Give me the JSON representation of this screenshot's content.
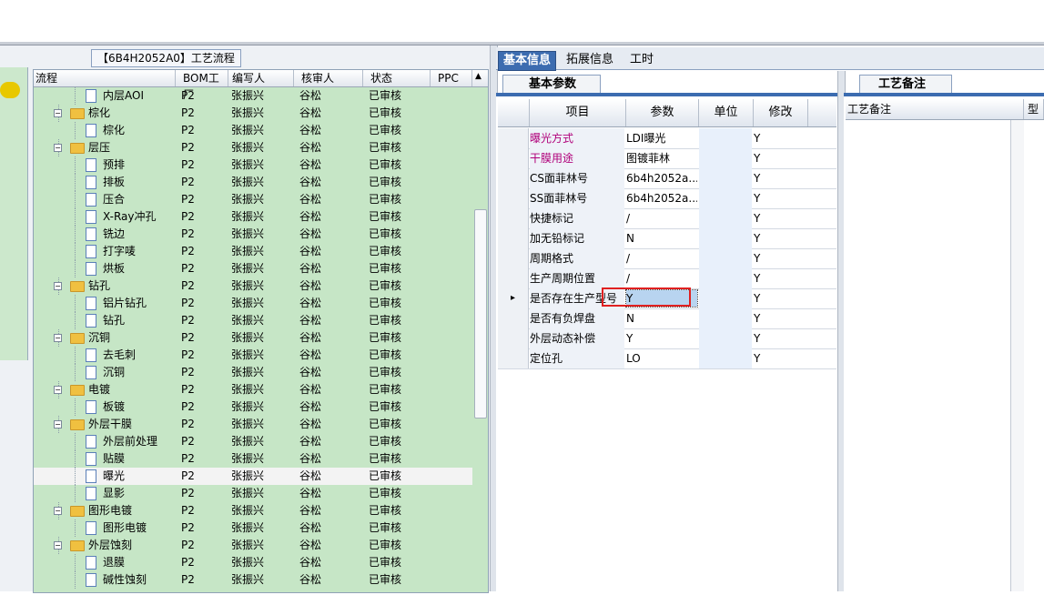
{
  "left": {
    "title": "【6B4H2052A0】工艺流程",
    "columns": [
      "流程",
      "BOM工厂",
      "编写人",
      "核审人",
      "状态",
      "PPC"
    ],
    "rows": [
      {
        "level": 2,
        "kind": "doc",
        "name": "内层AOI",
        "bom": "P2",
        "writer": "张振兴",
        "reviewer": "谷松",
        "status": "已审核"
      },
      {
        "level": 1,
        "kind": "folder",
        "name": "棕化",
        "bom": "P2",
        "writer": "张振兴",
        "reviewer": "谷松",
        "status": "已审核"
      },
      {
        "level": 2,
        "kind": "doc",
        "name": "棕化",
        "bom": "P2",
        "writer": "张振兴",
        "reviewer": "谷松",
        "status": "已审核"
      },
      {
        "level": 1,
        "kind": "folder",
        "name": "层压",
        "bom": "P2",
        "writer": "张振兴",
        "reviewer": "谷松",
        "status": "已审核"
      },
      {
        "level": 2,
        "kind": "doc",
        "name": "预排",
        "bom": "P2",
        "writer": "张振兴",
        "reviewer": "谷松",
        "status": "已审核"
      },
      {
        "level": 2,
        "kind": "doc",
        "name": "排板",
        "bom": "P2",
        "writer": "张振兴",
        "reviewer": "谷松",
        "status": "已审核"
      },
      {
        "level": 2,
        "kind": "doc",
        "name": "压合",
        "bom": "P2",
        "writer": "张振兴",
        "reviewer": "谷松",
        "status": "已审核"
      },
      {
        "level": 2,
        "kind": "doc",
        "name": "X-Ray冲孔",
        "bom": "P2",
        "writer": "张振兴",
        "reviewer": "谷松",
        "status": "已审核"
      },
      {
        "level": 2,
        "kind": "doc",
        "name": "铣边",
        "bom": "P2",
        "writer": "张振兴",
        "reviewer": "谷松",
        "status": "已审核"
      },
      {
        "level": 2,
        "kind": "doc",
        "name": "打字唛",
        "bom": "P2",
        "writer": "张振兴",
        "reviewer": "谷松",
        "status": "已审核"
      },
      {
        "level": 2,
        "kind": "doc",
        "name": "烘板",
        "bom": "P2",
        "writer": "张振兴",
        "reviewer": "谷松",
        "status": "已审核"
      },
      {
        "level": 1,
        "kind": "folder",
        "name": "钻孔",
        "bom": "P2",
        "writer": "张振兴",
        "reviewer": "谷松",
        "status": "已审核"
      },
      {
        "level": 2,
        "kind": "doc",
        "name": "铝片钻孔",
        "bom": "P2",
        "writer": "张振兴",
        "reviewer": "谷松",
        "status": "已审核"
      },
      {
        "level": 2,
        "kind": "doc",
        "name": "钻孔",
        "bom": "P2",
        "writer": "张振兴",
        "reviewer": "谷松",
        "status": "已审核"
      },
      {
        "level": 1,
        "kind": "folder",
        "name": "沉铜",
        "bom": "P2",
        "writer": "张振兴",
        "reviewer": "谷松",
        "status": "已审核"
      },
      {
        "level": 2,
        "kind": "doc",
        "name": "去毛刺",
        "bom": "P2",
        "writer": "张振兴",
        "reviewer": "谷松",
        "status": "已审核"
      },
      {
        "level": 2,
        "kind": "doc",
        "name": "沉铜",
        "bom": "P2",
        "writer": "张振兴",
        "reviewer": "谷松",
        "status": "已审核"
      },
      {
        "level": 1,
        "kind": "folder",
        "name": "电镀",
        "bom": "P2",
        "writer": "张振兴",
        "reviewer": "谷松",
        "status": "已审核"
      },
      {
        "level": 2,
        "kind": "doc",
        "name": "板镀",
        "bom": "P2",
        "writer": "张振兴",
        "reviewer": "谷松",
        "status": "已审核"
      },
      {
        "level": 1,
        "kind": "folder",
        "name": "外层干膜",
        "bom": "P2",
        "writer": "张振兴",
        "reviewer": "谷松",
        "status": "已审核"
      },
      {
        "level": 2,
        "kind": "doc",
        "name": "外层前处理",
        "bom": "P2",
        "writer": "张振兴",
        "reviewer": "谷松",
        "status": "已审核"
      },
      {
        "level": 2,
        "kind": "doc",
        "name": "贴膜",
        "bom": "P2",
        "writer": "张振兴",
        "reviewer": "谷松",
        "status": "已审核"
      },
      {
        "level": 2,
        "kind": "doc",
        "name": "曝光",
        "bom": "P2",
        "writer": "张振兴",
        "reviewer": "谷松",
        "status": "已审核",
        "selected": true
      },
      {
        "level": 2,
        "kind": "doc",
        "name": "显影",
        "bom": "P2",
        "writer": "张振兴",
        "reviewer": "谷松",
        "status": "已审核"
      },
      {
        "level": 1,
        "kind": "folder",
        "name": "图形电镀",
        "bom": "P2",
        "writer": "张振兴",
        "reviewer": "谷松",
        "status": "已审核"
      },
      {
        "level": 2,
        "kind": "doc",
        "name": "图形电镀",
        "bom": "P2",
        "writer": "张振兴",
        "reviewer": "谷松",
        "status": "已审核"
      },
      {
        "level": 1,
        "kind": "folder",
        "name": "外层蚀刻",
        "bom": "P2",
        "writer": "张振兴",
        "reviewer": "谷松",
        "status": "已审核"
      },
      {
        "level": 2,
        "kind": "doc",
        "name": "退膜",
        "bom": "P2",
        "writer": "张振兴",
        "reviewer": "谷松",
        "status": "已审核"
      },
      {
        "level": 2,
        "kind": "doc",
        "name": "碱性蚀刻",
        "bom": "P2",
        "writer": "张振兴",
        "reviewer": "谷松",
        "status": "已审核"
      }
    ]
  },
  "middle": {
    "tabs": [
      "基本信息",
      "拓展信息",
      "工时"
    ],
    "active_tab": 0,
    "subtab": "基本参数",
    "columns": [
      "项目",
      "参数",
      "单位",
      "修改"
    ],
    "rows": [
      {
        "item": "曝光方式",
        "param": "LDI曝光",
        "unit": "",
        "modify": "Y",
        "highlight": true
      },
      {
        "item": "干膜用途",
        "param": "图镀菲林",
        "unit": "",
        "modify": "Y",
        "highlight": true
      },
      {
        "item": "CS面菲林号",
        "param": "6b4h2052a...",
        "unit": "",
        "modify": "Y"
      },
      {
        "item": "SS面菲林号",
        "param": "6b4h2052a...",
        "unit": "",
        "modify": "Y"
      },
      {
        "item": "快捷标记",
        "param": "/",
        "unit": "",
        "modify": "Y"
      },
      {
        "item": "加无铅标记",
        "param": "N",
        "unit": "",
        "modify": "Y"
      },
      {
        "item": "周期格式",
        "param": "/",
        "unit": "",
        "modify": "Y"
      },
      {
        "item": "生产周期位置",
        "param": "/",
        "unit": "",
        "modify": "Y"
      },
      {
        "item": "是否存在生产型号",
        "param": "Y",
        "unit": "",
        "modify": "Y",
        "current": true
      },
      {
        "item": "是否有负焊盘",
        "param": "N",
        "unit": "",
        "modify": "Y"
      },
      {
        "item": "外层动态补偿",
        "param": "Y",
        "unit": "",
        "modify": "Y"
      },
      {
        "item": "定位孔",
        "param": "LO",
        "unit": "",
        "modify": "Y"
      }
    ]
  },
  "right": {
    "tab": "工艺备注",
    "columns": [
      "工艺备注",
      "型号"
    ]
  }
}
